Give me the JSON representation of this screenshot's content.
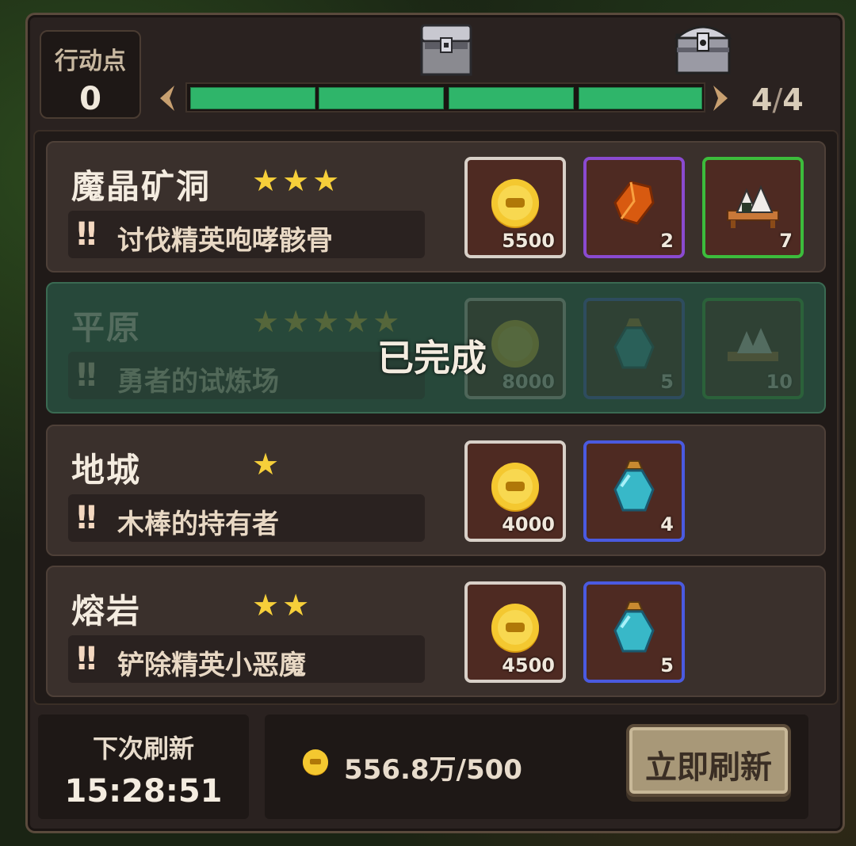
{
  "action_points": {
    "label": "行动点",
    "value": "0"
  },
  "progress": {
    "count_current": "4",
    "count_sep": "/",
    "count_total": "4",
    "filled_fraction": 1.0,
    "segments": 4
  },
  "quests": [
    {
      "name": "魔晶矿洞",
      "stars": "★★★",
      "task": "讨伐精英咆哮骸骨",
      "completed": false,
      "rewards": [
        {
          "icon": "gold-coin-icon",
          "qty": "5500",
          "rarity": "white"
        },
        {
          "icon": "amber-crystal-icon",
          "qty": "2",
          "rarity": "purple"
        },
        {
          "icon": "rice-ball-tray-icon",
          "qty": "7",
          "rarity": "green"
        }
      ]
    },
    {
      "name": "平原",
      "stars": "★★★★★",
      "task": "勇者的试炼场",
      "completed": true,
      "completed_label": "已完成",
      "rewards": [
        {
          "icon": "gold-coin-icon",
          "qty": "8000",
          "rarity": "white"
        },
        {
          "icon": "blue-potion-icon",
          "qty": "5",
          "rarity": "blue"
        },
        {
          "icon": "rice-ball-tray-icon",
          "qty": "10",
          "rarity": "green"
        }
      ]
    },
    {
      "name": "地城",
      "stars": "★",
      "task": "木棒的持有者",
      "completed": false,
      "rewards": [
        {
          "icon": "gold-coin-icon",
          "qty": "4000",
          "rarity": "white"
        },
        {
          "icon": "blue-potion-icon",
          "qty": "4",
          "rarity": "blue"
        }
      ]
    },
    {
      "name": "熔岩",
      "stars": "★★",
      "task": "铲除精英小恶魔",
      "completed": false,
      "rewards": [
        {
          "icon": "gold-coin-icon",
          "qty": "4500",
          "rarity": "white"
        },
        {
          "icon": "blue-potion-icon",
          "qty": "5",
          "rarity": "blue"
        }
      ]
    }
  ],
  "refresh": {
    "timer_label": "下次刷新",
    "timer_value": "15:28:51",
    "cost_text": "556.8万/500",
    "button_label": "立即刷新"
  },
  "colors": {
    "progress_fill": "#2fb56a",
    "star": "#f6cf3a",
    "completed_overlay": "#27483a"
  }
}
